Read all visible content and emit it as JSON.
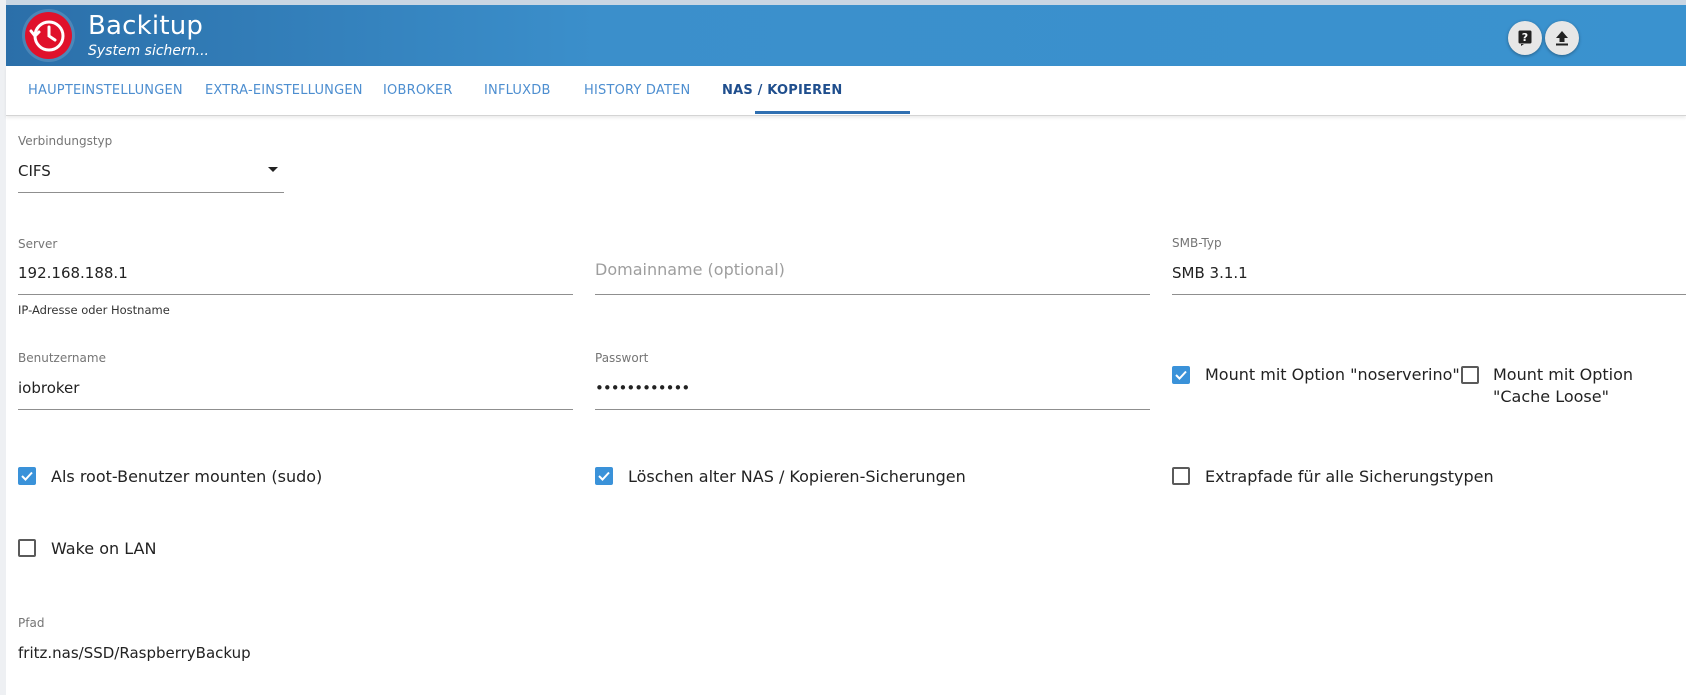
{
  "app": {
    "title": "Backitup",
    "subtitle": "System sichern..."
  },
  "header_buttons": [
    {
      "icon": "help-icon",
      "label": "?"
    },
    {
      "icon": "upload-icon"
    }
  ],
  "tabs": [
    {
      "label": "HAUPTEINSTELLUNGEN",
      "active": false
    },
    {
      "label": "EXTRA-EINSTELLUNGEN",
      "active": false
    },
    {
      "label": "IOBROKER",
      "active": false
    },
    {
      "label": "INFLUXDB",
      "active": false
    },
    {
      "label": "HISTORY DATEN",
      "active": false
    },
    {
      "label": "NAS / KOPIEREN",
      "active": true
    }
  ],
  "form": {
    "connection_type": {
      "label": "Verbindungstyp",
      "value": "CIFS"
    },
    "server": {
      "label": "Server",
      "value": "192.168.188.1",
      "helper": "IP-Adresse oder Hostname"
    },
    "domain": {
      "placeholder": "Domainname (optional)"
    },
    "smb_type": {
      "label": "SMB-Typ",
      "value": "SMB 3.1.1"
    },
    "username": {
      "label": "Benutzername",
      "value": "iobroker"
    },
    "password": {
      "label": "Passwort",
      "value": "••••••••••••"
    },
    "path": {
      "label": "Pfad",
      "value": "fritz.nas/SSD/RaspberryBackup"
    }
  },
  "checkboxes": {
    "noserverino": {
      "label": "Mount mit Option \"noserverino\"",
      "checked": true
    },
    "cache_loose": {
      "label": "Mount mit Option \"Cache Loose\"",
      "checked": false
    },
    "sudo": {
      "label": "Als root-Benutzer mounten (sudo)",
      "checked": true
    },
    "delete_old": {
      "label": "Löschen alter NAS / Kopieren-Sicherungen",
      "checked": true
    },
    "extrapaths": {
      "label": "Extrapfade für alle Sicherungstypen",
      "checked": false
    },
    "wol": {
      "label": "Wake on LAN",
      "checked": false
    }
  },
  "colors": {
    "header": "#3a92cf",
    "accent": "#3a92d9",
    "logo": "#e0112b",
    "tab_active": "#1f4e8d",
    "tab": "#4d8ed0"
  }
}
